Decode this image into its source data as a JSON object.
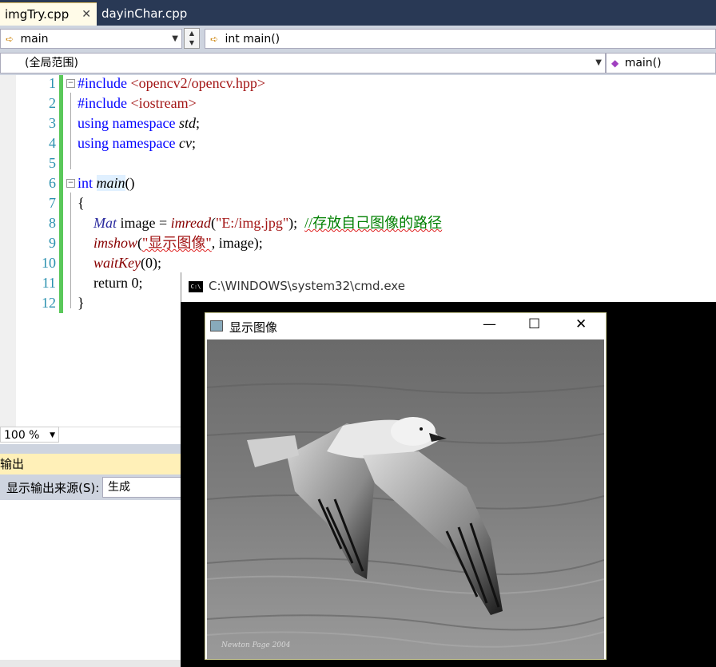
{
  "tabs": [
    {
      "label": "imgTry.cpp",
      "active": true,
      "close": "✕"
    },
    {
      "label": "dayinChar.cpp",
      "active": false
    }
  ],
  "nav": {
    "scope_left": "main",
    "function_right": "int main()",
    "global_scope": "(全局范围)",
    "member": "main()"
  },
  "editor": {
    "line_numbers": [
      "1",
      "2",
      "3",
      "4",
      "5",
      "6",
      "7",
      "8",
      "9",
      "10",
      "11",
      "12"
    ],
    "lines": {
      "l1a": "#include ",
      "l1b": "<opencv2/opencv.hpp>",
      "l2a": "#include ",
      "l2b": "<iostream>",
      "l3a": "using namespace ",
      "l3b": "std",
      "l3c": ";",
      "l4a": "using namespace ",
      "l4b": "cv",
      "l4c": ";",
      "l6a": "int ",
      "l6b": "main",
      "l6c": "()",
      "l7": "{",
      "l8a": "Mat",
      "l8b": " image = ",
      "l8c": "imread",
      "l8d": "(",
      "l8e": "\"E:/img.jpg\"",
      "l8f": ");  ",
      "l8g": "//存放自己图像的路径",
      "l9a": "imshow",
      "l9b": "(",
      "l9c": "\"显示图像\"",
      "l9d": ", image);",
      "l10a": "waitKey",
      "l10b": "(0);",
      "l11": "return 0;",
      "l12": "}"
    }
  },
  "zoom": "100 %",
  "output": {
    "title": "输出",
    "source_label": "显示输出来源(S):",
    "source_value": "生成"
  },
  "cmd": {
    "title": "C:\\WINDOWS\\system32\\cmd.exe",
    "icon": "C:\\"
  },
  "image_window": {
    "title": "显示图像",
    "controls": {
      "minimize": "—",
      "maximize": "☐",
      "close": "✕"
    },
    "signature": "Newton Page 2004"
  },
  "colors": {
    "tabbar": "#293955",
    "active_tab": "#fffbe8",
    "change_margin": "#5ac85a",
    "keyword": "#0000ff",
    "string": "#a31515",
    "comment": "#008000",
    "line_number": "#2b91af"
  }
}
